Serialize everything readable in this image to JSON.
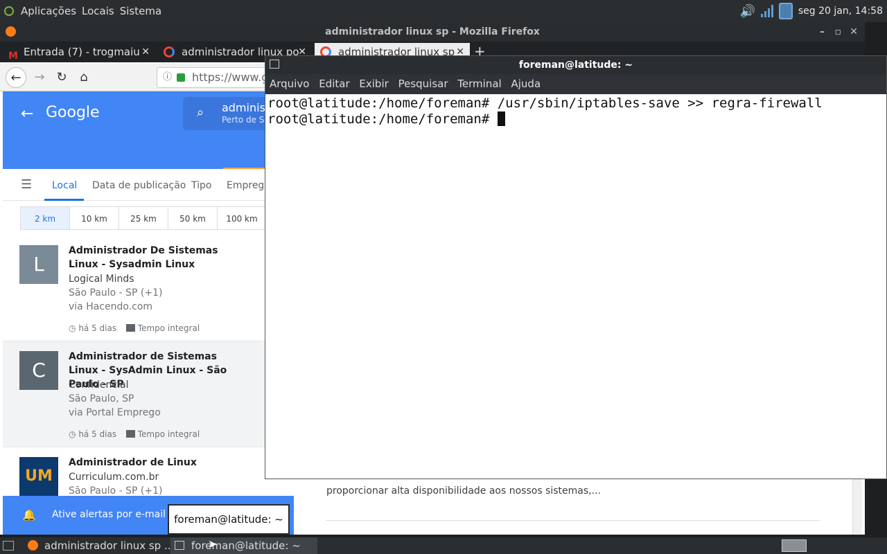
{
  "top_panel": {
    "menus": [
      "Aplicações",
      "Locais",
      "Sistema"
    ],
    "clock": "seg 20 jan, 14:58"
  },
  "firefox": {
    "window_title": "administrador linux sp - Mozilla Firefox",
    "tabs": [
      {
        "label": "Entrada (7) - trogmaiu",
        "icon": "gmail-icon"
      },
      {
        "label": "administrador linux po",
        "icon": "google-icon"
      },
      {
        "label": "administrador linux sp",
        "icon": "google-icon"
      }
    ],
    "url": "https://www.g"
  },
  "google": {
    "logo": "Google",
    "search_query": "administ",
    "search_sub": "Perto de Sã",
    "filters": [
      "Local",
      "Data de publicação",
      "Tipo",
      "Emprega"
    ],
    "distances": [
      "2 km",
      "10 km",
      "25 km",
      "50 km",
      "100 km"
    ],
    "jobs": [
      {
        "logo": "L",
        "title": "Administrador De Sistemas Linux - Sysadmin Linux",
        "company": "Logical Minds",
        "location": "São Paulo - SP (+1)",
        "via": "via Hacendo.com",
        "age": "há 5 dias",
        "type": "Tempo integral"
      },
      {
        "logo": "C",
        "title": "Administrador de Sistemas Linux - SysAdmin Linux - São Paulo - SP",
        "company": "Confidencial",
        "location": "São Paulo, SP",
        "via": "via Portal Emprego",
        "age": "há 5 dias",
        "type": "Tempo integral"
      },
      {
        "logo": "UM",
        "title": "Administrador de Linux",
        "company": "Curriculum.com.br",
        "location": "São Paulo - SP (+1)"
      }
    ],
    "alert_text": "Ative alertas por e-mail p/ a",
    "right_snippet": "proporcionar alta disponibilidade aos nossos sistemas,..."
  },
  "terminal": {
    "title": "foreman@latitude: ~",
    "menu": [
      "Arquivo",
      "Editar",
      "Exibir",
      "Pesquisar",
      "Terminal",
      "Ajuda"
    ],
    "lines": [
      "root@latitude:/home/foreman# /usr/sbin/iptables-save >> regra-firewall",
      "root@latitude:/home/foreman# "
    ]
  },
  "tooltip": "foreman@latitude: ~",
  "taskbar": {
    "items": [
      "administrador linux sp ...",
      "foreman@latitude: ~"
    ]
  },
  "colors": {
    "google_blue": "#4285f4",
    "panel": "#2b2e31",
    "ssl_green": "#2a9d3a"
  }
}
